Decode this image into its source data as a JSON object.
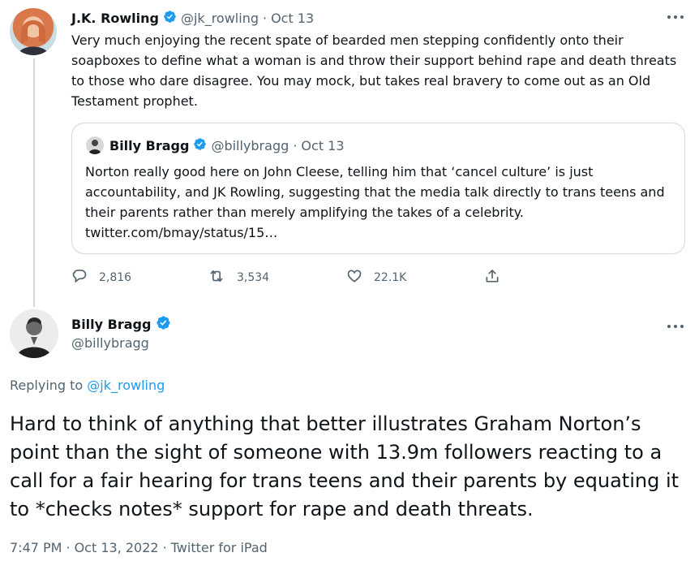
{
  "parent_tweet": {
    "author_name": "J.K. Rowling",
    "handle": "@jk_rowling",
    "separator": "·",
    "date": "Oct 13",
    "text": "Very much enjoying the recent spate of bearded men stepping confidently onto their soapboxes to define what a woman is and throw their support behind rape and death threats to those who dare disagree. You may mock, but takes real bravery to come out as an Old Testament prophet.",
    "quote": {
      "author_name": "Billy Bragg",
      "handle": "@billybragg",
      "date_line": "· Oct 13",
      "text": "Norton really good here on John Cleese, telling him that ‘cancel culture’ is just accountability, and JK Rowling, suggesting that the media talk directly to trans teens and their parents rather than merely amplifying the takes of a celebrity.",
      "link": "twitter.com/bmay/status/15…"
    },
    "actions": {
      "replies": "2,816",
      "retweets": "3,534",
      "likes": "22.1K"
    },
    "more_icon": "more-horizontal-icon"
  },
  "main_tweet": {
    "author_name": "Billy Bragg",
    "handle": "@billybragg",
    "replying_to_label": "Replying to",
    "replying_to_handle": "@jk_rowling",
    "text": "Hard to think of anything that better illustrates Graham Norton’s point than the sight of someone with 13.9m followers reacting to a call for a fair hearing for trans teens and their parents by equating it to *checks notes* support for rape and death threats.",
    "timestamp": "7:47 PM",
    "dot": "·",
    "date": "Oct 13, 2022",
    "source": "Twitter for iPad",
    "more_icon": "more-horizontal-icon"
  },
  "colors": {
    "verified": "#1d9bf0",
    "link": "#1d9bf0",
    "secondary_text": "#536471",
    "border": "#cfd9de"
  }
}
